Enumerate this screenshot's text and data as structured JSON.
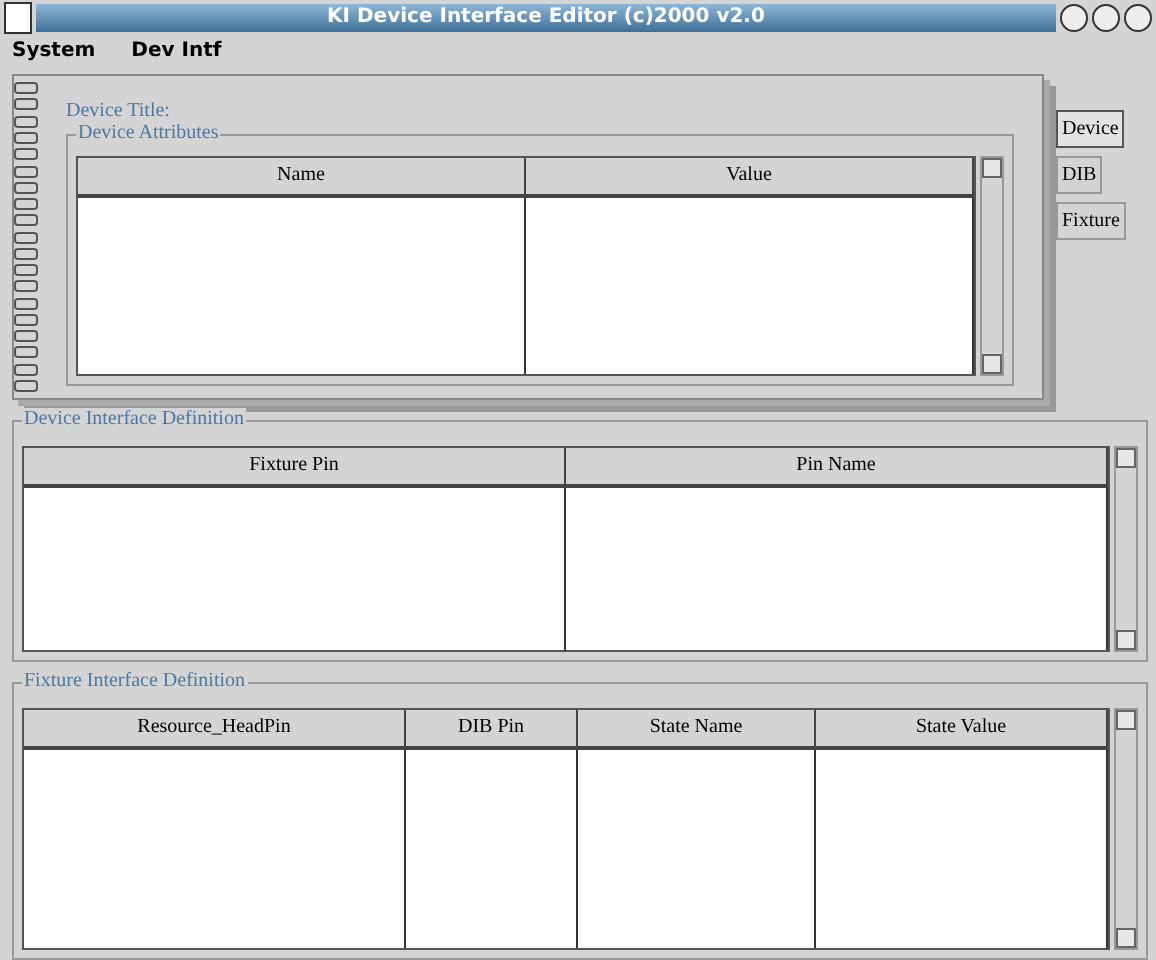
{
  "window": {
    "title": "KI Device Interface Editor (c)2000 v2.0"
  },
  "menu": [
    "System",
    "Dev Intf"
  ],
  "notebook": {
    "tabs": [
      {
        "label": "Device",
        "selected": true
      },
      {
        "label": "DIB",
        "selected": false
      },
      {
        "label": "Fixture",
        "selected": false
      }
    ],
    "title_label": "Device Title:",
    "attributes": {
      "title": "Device Attributes",
      "columns": [
        "Name",
        "Value"
      ]
    }
  },
  "sections": [
    {
      "title": "Device Interface Definition",
      "columns": [
        "Fixture Pin",
        "Pin Name"
      ]
    },
    {
      "title": "Fixture Interface Definition",
      "columns": [
        "Resource_HeadPin",
        "DIB Pin",
        "State Name",
        "State Value"
      ]
    }
  ]
}
